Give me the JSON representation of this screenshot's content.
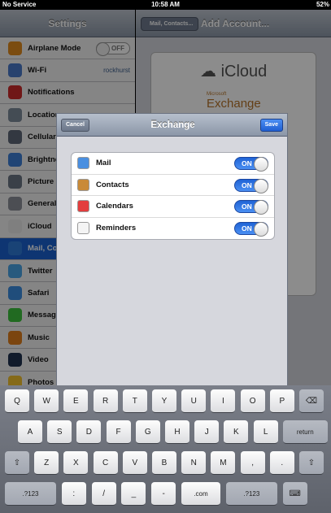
{
  "status_bar": {
    "carrier": "No Service",
    "time": "10:58 AM",
    "battery": "52%"
  },
  "settings": {
    "title": "Settings",
    "items": [
      {
        "label": "Airplane Mode",
        "value": "",
        "toggle": "OFF",
        "icon": "airplane-icon",
        "color": "#e08a1e"
      },
      {
        "label": "Wi-Fi",
        "value": "rockhurst",
        "toggle": "",
        "icon": "wifi-icon",
        "color": "#4a78c9"
      },
      {
        "label": "Notifications",
        "value": "",
        "toggle": "",
        "icon": "notifications-icon",
        "color": "#cc2b2b"
      },
      {
        "label": "Location",
        "value": "",
        "toggle": "",
        "icon": "location-icon",
        "color": "#7d8a9a"
      },
      {
        "label": "Cellular",
        "value": "",
        "toggle": "",
        "icon": "cellular-icon",
        "color": "#5d6677"
      },
      {
        "label": "Brightne",
        "value": "",
        "toggle": "",
        "icon": "brightness-icon",
        "color": "#3c7fd6"
      },
      {
        "label": "Picture F",
        "value": "",
        "toggle": "",
        "icon": "picture-frame-icon",
        "color": "#6a7584"
      },
      {
        "label": "General",
        "value": "",
        "toggle": "",
        "icon": "gear-icon",
        "color": "#8a8f98"
      },
      {
        "label": "iCloud",
        "value": "",
        "toggle": "",
        "icon": "icloud-icon",
        "color": "#e8e8e8"
      },
      {
        "label": "Mail, Co",
        "value": "",
        "toggle": "",
        "icon": "mail-icon",
        "color": "#2f7ad8"
      },
      {
        "label": "Twitter",
        "value": "",
        "toggle": "",
        "icon": "twitter-icon",
        "color": "#4aa5e6"
      },
      {
        "label": "Safari",
        "value": "",
        "toggle": "",
        "icon": "safari-icon",
        "color": "#3b8de0"
      },
      {
        "label": "Message",
        "value": "",
        "toggle": "",
        "icon": "messages-icon",
        "color": "#3cc23c"
      },
      {
        "label": "Music",
        "value": "",
        "toggle": "",
        "icon": "music-icon",
        "color": "#e07f1c"
      },
      {
        "label": "Video",
        "value": "",
        "toggle": "",
        "icon": "video-icon",
        "color": "#20324f"
      },
      {
        "label": "Photos",
        "value": "",
        "toggle": "",
        "icon": "photos-icon",
        "color": "#f2c12e"
      }
    ]
  },
  "detail": {
    "back_label": "Mail, Contacts...",
    "title": "Add Account...",
    "icloud": "iCloud",
    "exchange_ms": "Microsoft",
    "exchange": "Exchange"
  },
  "modal": {
    "cancel": "Cancel",
    "title": "Exchange",
    "save": "Save",
    "services": [
      {
        "label": "Mail",
        "state": "ON",
        "icon": "mail-icon",
        "color": "#4a8fe0"
      },
      {
        "label": "Contacts",
        "state": "ON",
        "icon": "contacts-icon",
        "color": "#c98a38"
      },
      {
        "label": "Calendars",
        "state": "ON",
        "icon": "calendar-icon",
        "color": "#e33d3d"
      },
      {
        "label": "Reminders",
        "state": "ON",
        "icon": "reminders-icon",
        "color": "#f4f4f4"
      }
    ]
  },
  "keyboard": {
    "rows": [
      [
        "Q",
        "W",
        "E",
        "R",
        "T",
        "Y",
        "U",
        "I",
        "O",
        "P",
        "⌫"
      ],
      [
        "A",
        "S",
        "D",
        "F",
        "G",
        "H",
        "J",
        "K",
        "L",
        "return"
      ],
      [
        "⇧",
        "Z",
        "X",
        "C",
        "V",
        "B",
        "N",
        "M",
        ",",
        ".",
        "⇧"
      ],
      [
        ".?123",
        ":",
        "/",
        "_",
        "-",
        ".com",
        ".?123",
        "⌨"
      ]
    ]
  }
}
